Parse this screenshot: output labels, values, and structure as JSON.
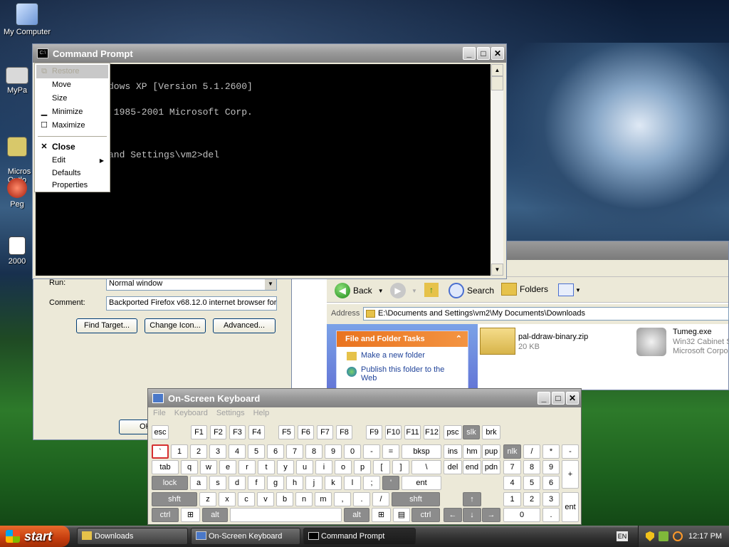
{
  "desktop": {
    "icons": [
      {
        "label": "My Computer"
      },
      {
        "label": "MyPa"
      },
      {
        "label": "Micros\nOutlo"
      },
      {
        "label": "Peg"
      },
      {
        "label": "2000"
      }
    ]
  },
  "cmd": {
    "title": "Command Prompt",
    "lines": [
      "dows XP [Version 5.1.2600]",
      " 1985-2001 Microsoft Corp.",
      "",
      "and Settings\\vm2>del"
    ],
    "menu": {
      "restore": "Restore",
      "move": "Move",
      "size": "Size",
      "minimize": "Minimize",
      "maximize": "Maximize",
      "close": "Close",
      "edit": "Edit",
      "defaults": "Defaults",
      "properties": "Properties"
    }
  },
  "props": {
    "run_label": "Run:",
    "run_value": "Normal window",
    "comment_label": "Comment:",
    "comment_value": "Backported Firefox v68.12.0 internet browser for \\",
    "find_target": "Find Target...",
    "change_icon": "Change Icon...",
    "advanced": "Advanced...",
    "ok": "OK"
  },
  "explorer": {
    "back": "Back",
    "search": "Search",
    "folders": "Folders",
    "address_label": "Address",
    "address": "E:\\Documents and Settings\\vm2\\My Documents\\Downloads",
    "tasks_title": "File and Folder Tasks",
    "task1": "Make a new folder",
    "task2": "Publish this folder to the Web",
    "files": [
      {
        "name": "pal-ddraw-binary.zip",
        "meta": "20 KB"
      },
      {
        "name": "Tumeg.exe",
        "meta": "Win32 Cabinet S",
        "meta2": "Microsoft Corpo"
      }
    ]
  },
  "osk": {
    "title": "On-Screen Keyboard",
    "menu": [
      "File",
      "Keyboard",
      "Settings",
      "Help"
    ]
  },
  "taskbar": {
    "start": "start",
    "items": [
      "Downloads",
      "On-Screen Keyboard",
      "Command Prompt"
    ],
    "lang": "EN",
    "clock": "12:17 PM"
  }
}
